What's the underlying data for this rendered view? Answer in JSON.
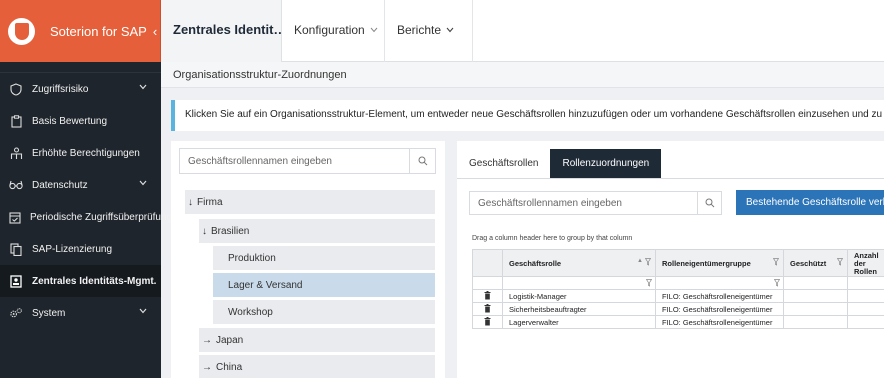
{
  "brand": {
    "title": "Soterion for SAP",
    "collapse": "‹"
  },
  "sidebar": {
    "items": [
      {
        "label": "Zugriffsrisiko",
        "icon": "shield-icon",
        "has_submenu": true
      },
      {
        "label": "Basis Bewertung",
        "icon": "clipboard-icon",
        "has_submenu": false
      },
      {
        "label": "Erhöhte Berechtigungen",
        "icon": "user-star-icon",
        "has_submenu": false
      },
      {
        "label": "Datenschutz",
        "icon": "glasses-icon",
        "has_submenu": true
      },
      {
        "label": "Periodische Zugriffsüberprüfung",
        "icon": "calendar-check-icon",
        "has_submenu": false
      },
      {
        "label": "SAP-Lizenzierung",
        "icon": "copy-icon",
        "has_submenu": false
      },
      {
        "label": "Zentrales Identitäts-Mgmt.",
        "icon": "id-card-icon",
        "has_submenu": false,
        "active": true
      },
      {
        "label": "System",
        "icon": "gears-icon",
        "has_submenu": true
      }
    ]
  },
  "topbar": {
    "active_tab": "Zentrales Identit…",
    "menus": [
      {
        "label": "Konfiguration"
      },
      {
        "label": "Berichte"
      }
    ]
  },
  "section": {
    "title": "Organisationsstruktur-Zuordnungen"
  },
  "banner": {
    "text": "Klicken Sie auf ein Organisationsstruktur-Element, um entweder neue Geschäftsrollen hinzuzufügen oder um vorhandene Geschäftsrollen einzusehen und zu pflegen."
  },
  "tree": {
    "search_placeholder": "Geschäftsrollennamen eingeben",
    "nodes": [
      {
        "label": "Firma",
        "arrow": "↓",
        "level": 0
      },
      {
        "label": "Brasilien",
        "arrow": "↓",
        "level": 1
      },
      {
        "label": "Produktion",
        "arrow": "",
        "level": 2
      },
      {
        "label": "Lager & Versand",
        "arrow": "",
        "level": 2,
        "selected": true
      },
      {
        "label": "Workshop",
        "arrow": "",
        "level": 2
      },
      {
        "label": "Japan",
        "arrow": "→",
        "level": 1
      },
      {
        "label": "China",
        "arrow": "→",
        "level": 1
      }
    ]
  },
  "right": {
    "tabs": [
      {
        "label": "Geschäftsrollen",
        "active": false
      },
      {
        "label": "Rollenzuordnungen",
        "active": true
      }
    ],
    "search_placeholder": "Geschäftsrollennamen eingeben",
    "link_button": "Bestehende Geschäftsrolle verknüpfen",
    "group_hint": "Drag a column header here to group by that column",
    "columns": [
      "",
      "Geschäftsrolle",
      "Rolleneigentümergruppe",
      "Geschützt",
      "Anzahl der Rollen"
    ],
    "rows": [
      {
        "role": "Logistik-Manager",
        "group": "FILO: Geschäftsrolleneigentümer"
      },
      {
        "role": "Sicherheitsbeauftragter",
        "group": "FILO: Geschäftsrolleneigentümer"
      },
      {
        "role": "Lagerverwalter",
        "group": "FILO: Geschäftsrolleneigentümer"
      }
    ]
  },
  "colors": {
    "brand": "#e5603a",
    "sidebar": "#1f252c",
    "tab_active": "#1f2a37",
    "button": "#2c74b8",
    "banner_accent": "#5ab4de",
    "selected_node": "#c9dbea"
  }
}
